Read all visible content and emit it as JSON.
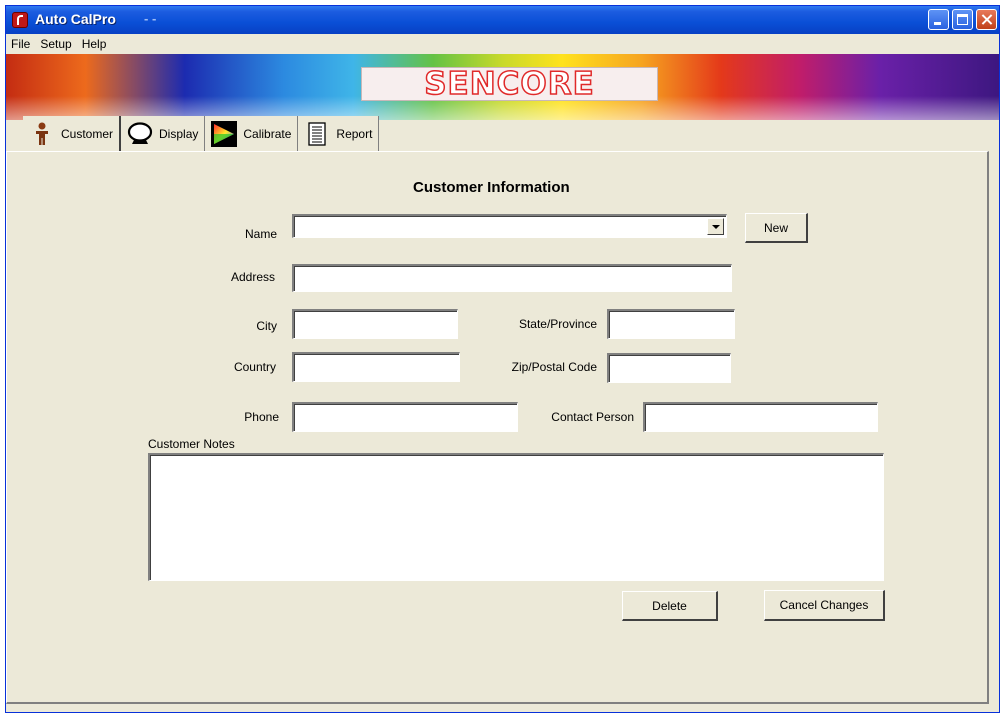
{
  "window": {
    "title": "Auto CalPro",
    "title_suffix": "- -",
    "accent": "#0a4fd6"
  },
  "menu": [
    "File",
    "Setup",
    "Help"
  ],
  "banner": {
    "logo": "SENCORE",
    "logo_color": "#e02a2a"
  },
  "tabs": [
    {
      "label": "Customer",
      "icon": "person-icon",
      "active": true
    },
    {
      "label": "Display",
      "icon": "monitor-icon",
      "active": false
    },
    {
      "label": "Calibrate",
      "icon": "color-triangle-icon",
      "active": false
    },
    {
      "label": "Report",
      "icon": "document-icon",
      "active": false
    }
  ],
  "form": {
    "heading": "Customer Information",
    "name": {
      "label": "Name",
      "value": ""
    },
    "address": {
      "label": "Address",
      "value": ""
    },
    "city": {
      "label": "City",
      "value": ""
    },
    "state": {
      "label": "State/Province",
      "value": ""
    },
    "country": {
      "label": "Country",
      "value": ""
    },
    "zip": {
      "label": "Zip/Postal Code",
      "value": ""
    },
    "phone": {
      "label": "Phone",
      "value": ""
    },
    "contact": {
      "label": "Contact Person",
      "value": ""
    },
    "notes": {
      "label": "Customer Notes",
      "value": ""
    }
  },
  "buttons": {
    "new": "New",
    "delete": "Delete",
    "cancel": "Cancel Changes"
  }
}
